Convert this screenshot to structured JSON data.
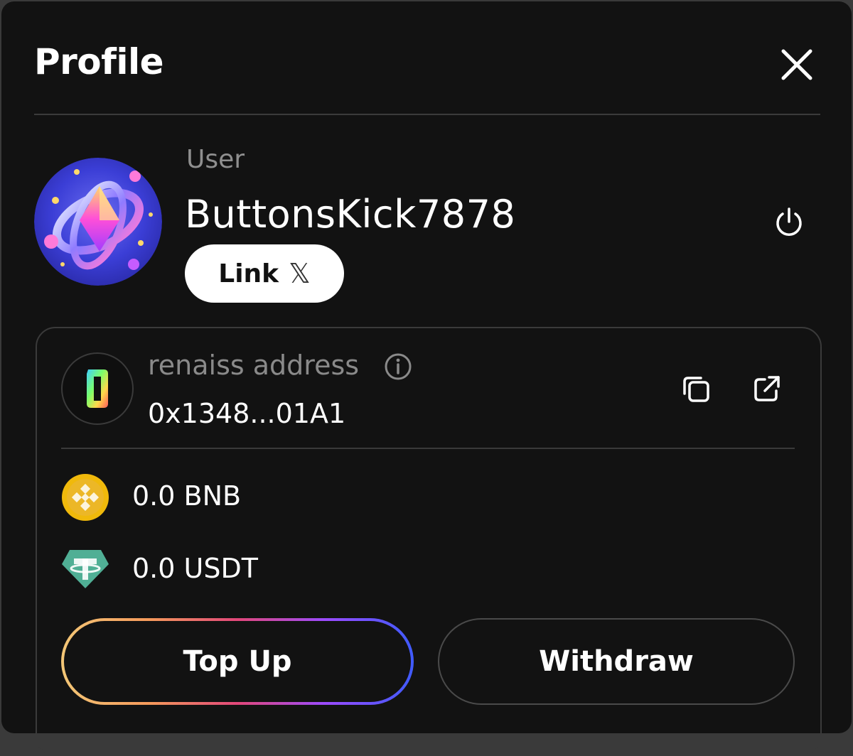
{
  "header": {
    "title": "Profile",
    "close_icon": "close-icon"
  },
  "user": {
    "label": "User",
    "username": "ButtonsKick7878",
    "link_button": {
      "label": "Link",
      "icon": "x-logo-icon",
      "glyph": "𝕏"
    },
    "power_icon": "power-icon"
  },
  "wallet": {
    "address_label": "renaiss address",
    "address": "0x1348...01A1",
    "info_icon": "info-icon",
    "copy_icon": "copy-icon",
    "external_link_icon": "external-link-icon",
    "tokens": [
      {
        "text": "0.0 BNB",
        "icon": "bnb-coin-icon",
        "color": "#F0B90B"
      },
      {
        "text": "0.0 USDT",
        "icon": "tether-icon",
        "color": "#50AF95"
      }
    ]
  },
  "actions": {
    "top_up": "Top Up",
    "withdraw": "Withdraw"
  },
  "colors": {
    "background": "#121212",
    "border": "#3a3a3a",
    "muted_text": "#8f8f8f"
  }
}
